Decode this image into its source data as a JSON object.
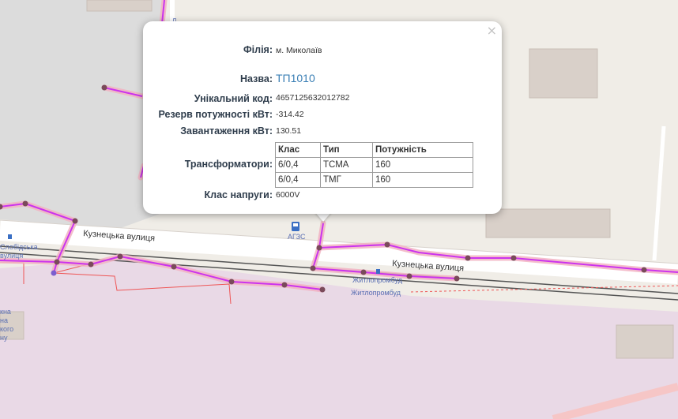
{
  "map": {
    "labels": {
      "street_1": "Кузнецька вулиця",
      "street_2": "Кузнецька вулиця",
      "poi_gas": "АГЗС",
      "poi_zhytlo_1": "Житлопромбуд",
      "poi_zhytlo_2": "Житлопромбуд",
      "poi_slobidska": "Слобідська",
      "poi_vulytsia": "вулиця",
      "poi_frag_1": "кна",
      "poi_frag_2": "на",
      "poi_frag_3": "кого",
      "poi_frag_4": "ну"
    },
    "colors": {
      "power_line": "#cc33ee",
      "power_line_halo": "#f2b3c3",
      "node": "#7a4a5a",
      "road": "#ffffff",
      "rail": "#555555",
      "zone": "#e9d9e6",
      "red_line": "#ee5555"
    }
  },
  "popup": {
    "close_symbol": "×",
    "fields": {
      "branch_label": "Філія:",
      "branch_value": "м. Миколаїв",
      "name_label": "Назва:",
      "name_value": "ТП1010",
      "code_label": "Унікальний код:",
      "code_value": "4657125632012782",
      "reserve_label": "Резерв потужності кВт:",
      "reserve_value": "-314.42",
      "load_label": "Завантаження кВт:",
      "load_value": "130.51",
      "transformers_label": "Трансформатори:",
      "voltage_label": "Клас напруги:",
      "voltage_value": "6000V"
    },
    "transformers_table": {
      "headers": [
        "Клас",
        "Тип",
        "Потужність"
      ],
      "rows": [
        [
          "6/0,4",
          "ТСМА",
          "160"
        ],
        [
          "6/0,4",
          "ТМГ",
          "160"
        ]
      ]
    }
  }
}
